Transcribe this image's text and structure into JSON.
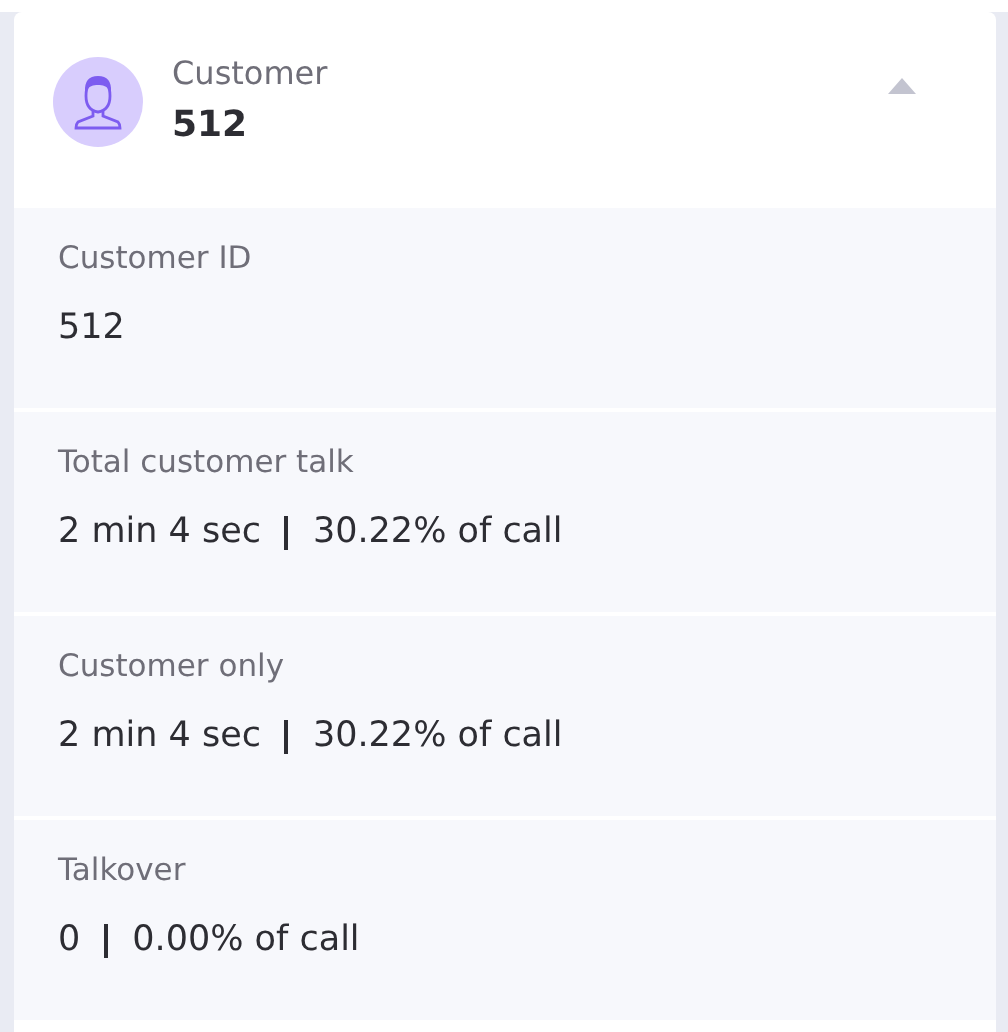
{
  "header": {
    "label": "Customer",
    "value": "512",
    "expanded": true
  },
  "sections": [
    {
      "kind": "single",
      "label": "Customer ID",
      "value": "512"
    },
    {
      "kind": "split",
      "label": "Total customer talk",
      "value": "2 min 4 sec",
      "share": "30.22% of call"
    },
    {
      "kind": "split",
      "label": "Customer only",
      "value": "2 min 4 sec",
      "share": "30.22% of call"
    },
    {
      "kind": "split",
      "label": "Talkover",
      "value": "0",
      "share": "0.00% of call"
    }
  ]
}
